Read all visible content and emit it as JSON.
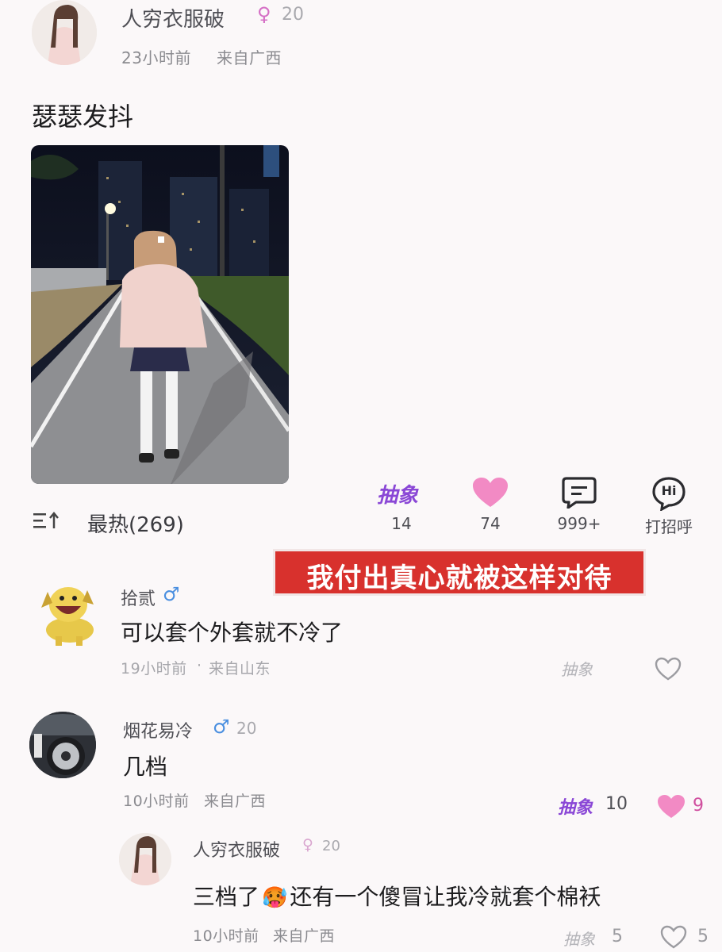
{
  "post": {
    "author": "人穷衣服破",
    "gender_symbol": "♀",
    "level": "20",
    "time": "23小时前",
    "location": "来自广西",
    "text": "瑟瑟发抖"
  },
  "actions": {
    "chouxiang_label": "抽象",
    "chouxiang_count": "14",
    "like_count": "74",
    "comment_count": "999+",
    "greet_icon_text": "Hi",
    "greet_label": "打招呼"
  },
  "sort": {
    "label": "最热(269)"
  },
  "banner": {
    "text": "我付出真心就被这样对待"
  },
  "comments": [
    {
      "author": "拾贰",
      "gender_symbol": "♂",
      "level": "",
      "text": "可以套个外套就不冷了",
      "time": "19小时前",
      "separator": "·",
      "location": "来自山东",
      "chouxiang_label": "抽象",
      "chouxiang_count": "",
      "like_count": ""
    },
    {
      "author": "烟花易冷",
      "gender_symbol": "♂",
      "level": "20",
      "text": "几档",
      "time": "10小时前",
      "location": "来自广西",
      "chouxiang_label": "抽象",
      "chouxiang_count": "10",
      "like_count": "9"
    },
    {
      "author": "人穷衣服破",
      "gender_symbol": "♀",
      "level": "20",
      "text_part1": "三档了",
      "emoji": "🥵",
      "text_part2": "还有一个傻冒让我冷就套个棉袄",
      "time": "10小时前",
      "location": "来自广西",
      "chouxiang_label": "抽象",
      "chouxiang_count": "5",
      "like_count": "5"
    }
  ],
  "colors": {
    "accent_purple": "#8a47d6",
    "heart_pink": "#f28ac4",
    "banner_red": "#d8312d",
    "gender_female": "#d56fc5",
    "gender_male": "#4a8fe0"
  }
}
